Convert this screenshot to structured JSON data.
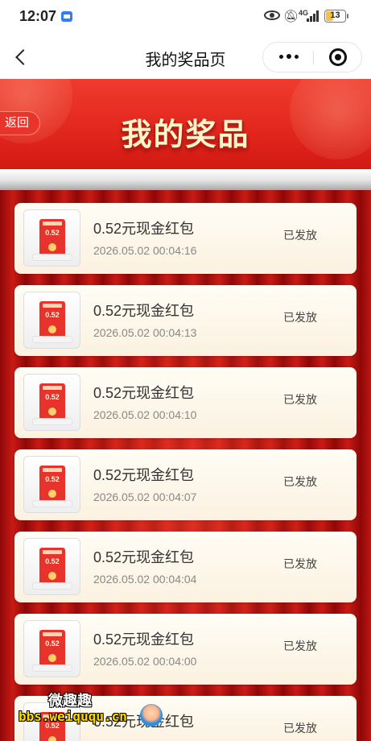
{
  "status_bar": {
    "time": "12:07",
    "network": "4G",
    "battery": "13"
  },
  "nav": {
    "title": "我的奖品页"
  },
  "banner": {
    "back_label": "返回",
    "headline": "我的奖品"
  },
  "prize_thumb_amount": "0.52",
  "prizes": [
    {
      "name": "0.52元现金红包",
      "time": "2026.05.02 00:04:16",
      "status": "已发放"
    },
    {
      "name": "0.52元现金红包",
      "time": "2026.05.02 00:04:13",
      "status": "已发放"
    },
    {
      "name": "0.52元现金红包",
      "time": "2026.05.02 00:04:10",
      "status": "已发放"
    },
    {
      "name": "0.52元现金红包",
      "time": "2026.05.02 00:04:07",
      "status": "已发放"
    },
    {
      "name": "0.52元现金红包",
      "time": "2026.05.02 00:04:04",
      "status": "已发放"
    },
    {
      "name": "0.52元现金红包",
      "time": "2026.05.02 00:04:00",
      "status": "已发放"
    },
    {
      "name": "0.52元现金红包",
      "time": "",
      "status": "已发放"
    }
  ],
  "watermark": {
    "title": "微趣趣",
    "url": "bbs.weiququ.cn"
  },
  "colors": {
    "banner_red": "#e1261d",
    "curtain_red": "#b40f0f",
    "card_bg": "#fdf7ea",
    "headline_gold": "#fff6cc"
  }
}
